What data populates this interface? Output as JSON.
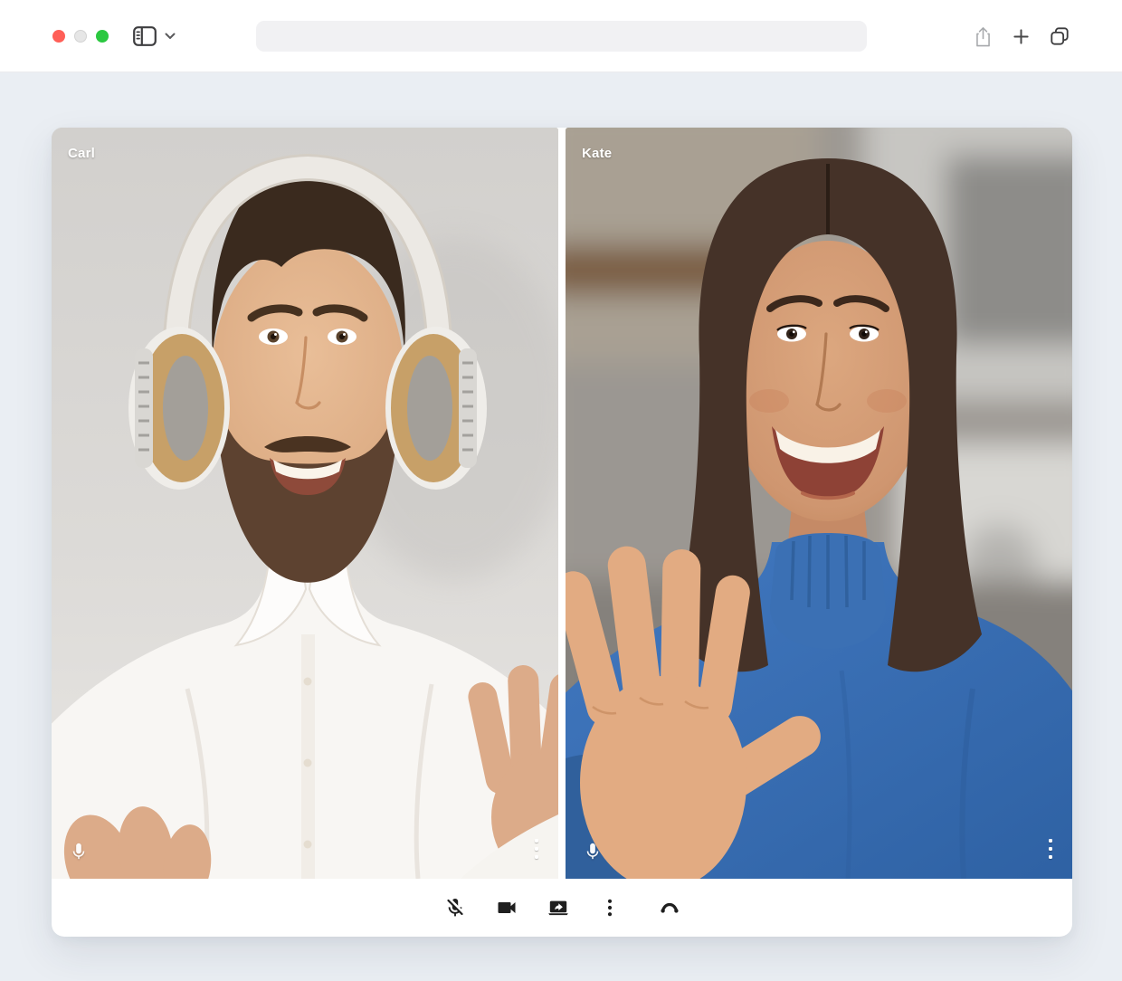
{
  "browser": {
    "url_value": "",
    "traffic_lights": {
      "close_color": "#FF5F57",
      "minimize_color": "#E6E6E6",
      "zoom_color": "#2BC840"
    },
    "toolbar_icons": [
      "sidebar-toggle",
      "chevron-down",
      "share",
      "new-tab",
      "tab-overview"
    ]
  },
  "call": {
    "participants": [
      {
        "name": "Carl",
        "overlay_icons": [
          "microphone",
          "more-vertical"
        ]
      },
      {
        "name": "Kate",
        "overlay_icons": [
          "microphone",
          "more-vertical"
        ]
      }
    ],
    "toolbar": {
      "icon_color": "#1F1F1F",
      "buttons": [
        {
          "id": "mute-toggle",
          "icon": "mic-off"
        },
        {
          "id": "camera-toggle",
          "icon": "video-camera"
        },
        {
          "id": "share-screen",
          "icon": "screen-share"
        },
        {
          "id": "more-options",
          "icon": "more-vertical"
        },
        {
          "id": "end-call",
          "icon": "phone-hang-up"
        }
      ]
    }
  },
  "colors": {
    "page_background": "#EAEEF3",
    "card_background": "#FFFFFF"
  }
}
